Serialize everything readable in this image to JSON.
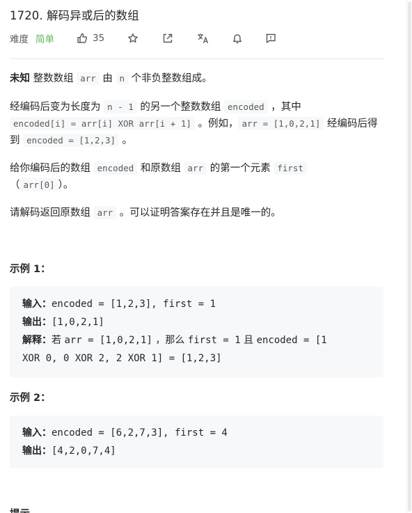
{
  "problem": {
    "title": "1720. 解码异或后的数组",
    "difficulty_label": "难度",
    "difficulty": "简单",
    "likes": "35"
  },
  "description": {
    "p1": {
      "a": "未知",
      "b": " 整数数组 ",
      "c": "arr",
      "d": " 由 ",
      "e": "n",
      "f": " 个非负整数组成。"
    },
    "p2": {
      "a": "经编码后变为长度为 ",
      "b": "n - 1",
      "c": " 的另一个整数数组 ",
      "d": "encoded",
      "e": " ，其中",
      "f": "encoded[i] = arr[i] XOR arr[i + 1]",
      "g": " 。例如，",
      "h": "arr = [1,0,2,1]",
      "i": " 经编码后得到 ",
      "j": "encoded = [1,2,3]",
      "k": " 。"
    },
    "p3": {
      "a": "给你编码后的数组 ",
      "b": "encoded",
      "c": " 和原数组 ",
      "d": "arr",
      "e": " 的第一个元素 ",
      "f": "first",
      "g": "（",
      "h": "arr[0]",
      "i": "）。"
    },
    "p4": {
      "a": "请解码返回原数组 ",
      "b": "arr",
      "c": " 。可以证明答案存在并且是唯一的。"
    }
  },
  "examples": [
    {
      "title": "示例 1：",
      "input_label": "输入：",
      "input": "encoded = [1,2,3], first = 1",
      "output_label": "输出：",
      "output": "[1,0,2,1]",
      "explain_label": "解释：",
      "explain_a": "若 ",
      "explain_b": "arr = [1,0,2,1]",
      "explain_c": " ，那么 ",
      "explain_d": "first = 1",
      "explain_e": " 且 ",
      "explain_f": "encoded = [1",
      "explain_g": "XOR 0, 0 XOR 2, 2 XOR 1] = [1,2,3]"
    },
    {
      "title": "示例 2：",
      "input_label": "输入：",
      "input": "encoded = [6,2,7,3], first = 4",
      "output_label": "输出：",
      "output": "[4,2,0,7,4]"
    }
  ],
  "footer_cut": "提示",
  "icons": [
    "thumbs-up-icon",
    "star-icon",
    "share-icon",
    "translate-icon",
    "bell-icon",
    "feedback-icon"
  ],
  "colors": {
    "easy": "#5cb85c",
    "code_bg": "#f7f8fa",
    "text": "#262626"
  }
}
